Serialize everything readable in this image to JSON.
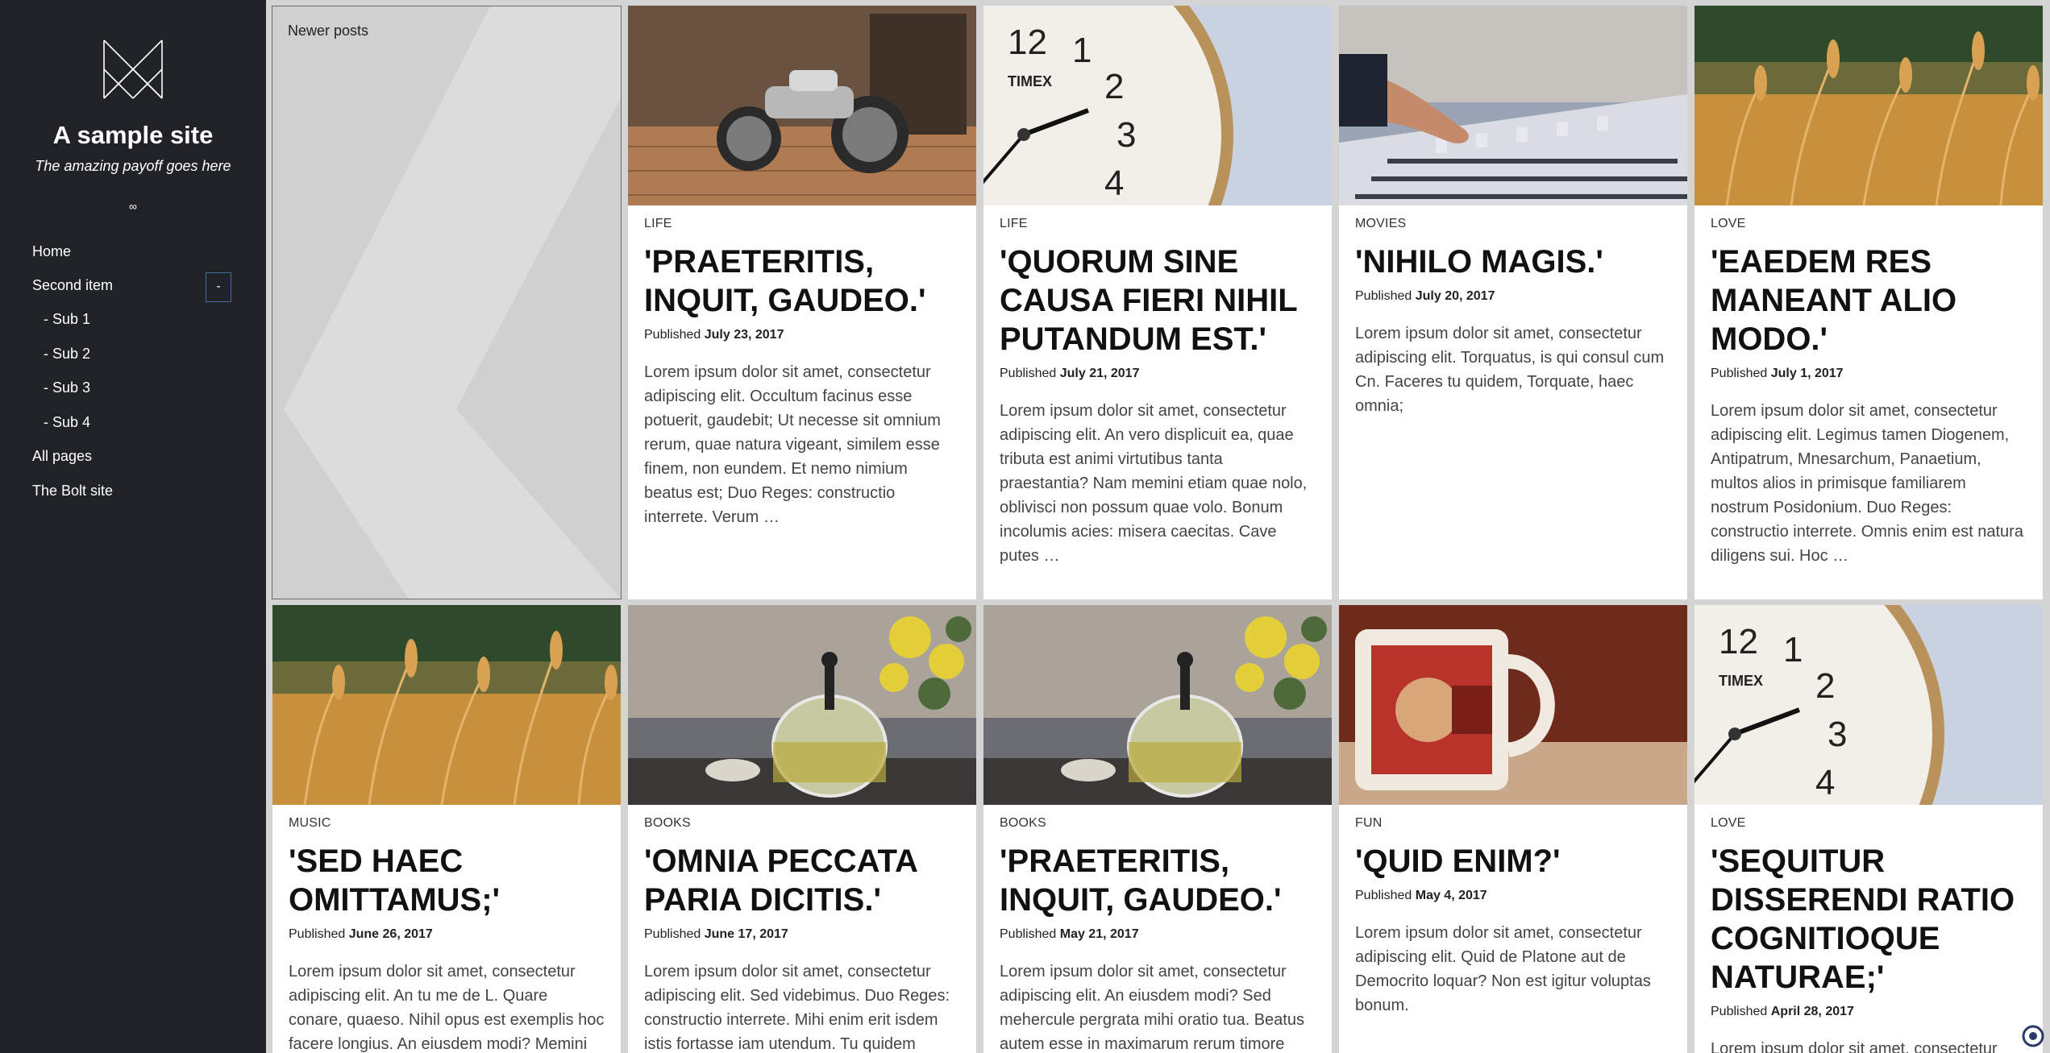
{
  "sidebar": {
    "title": "A sample site",
    "payoff": "The amazing payoff goes here",
    "separator": "∞",
    "nav": [
      {
        "label": "Home"
      },
      {
        "label": "Second item"
      },
      {
        "label": "- Sub 1"
      },
      {
        "label": "- Sub 2"
      },
      {
        "label": "- Sub 3"
      },
      {
        "label": "- Sub 4"
      },
      {
        "label": "All pages"
      },
      {
        "label": "The Bolt site"
      }
    ],
    "toggle_label": "-"
  },
  "pager": {
    "newer_label": "Newer posts"
  },
  "published_label": "Published",
  "posts": [
    {
      "category": "LIFE",
      "title": "'PRAETERITIS, INQUIT, GAUDEO.'",
      "date": "July 23, 2017",
      "image": "motorcycle-garage",
      "excerpt": "Lorem ipsum dolor sit amet, consectetur adipiscing elit. Occultum facinus esse potuerit, gaudebit; Ut necesse sit omnium rerum, quae natura vigeant, similem esse finem, non eundem. Et nemo nimium beatus est; Duo Reges: constructio interrete. Verum …"
    },
    {
      "category": "LIFE",
      "title": "'QUORUM SINE CAUSA FIERI NIHIL PUTANDUM EST.'",
      "date": "July 21, 2017",
      "image": "clock",
      "excerpt": "Lorem ipsum dolor sit amet, consectetur adipiscing elit. An vero displicuit ea, quae tributa est animi virtutibus tanta praestantia? Nam memini etiam quae nolo, oblivisci non possum quae volo. Bonum incolumis acies: misera caecitas. Cave putes …"
    },
    {
      "category": "MOVIES",
      "title": "'NIHILO MAGIS.'",
      "date": "July 20, 2017",
      "image": "mixing-desk",
      "excerpt": "Lorem ipsum dolor sit amet, consectetur adipiscing elit. Torquatus, is qui consul cum Cn. Faceres tu quidem, Torquate, haec omnia;"
    },
    {
      "category": "LOVE",
      "title": "'EAEDEM RES MANEANT ALIO MODO.'",
      "date": "July 1, 2017",
      "image": "wheat-field",
      "excerpt": "Lorem ipsum dolor sit amet, consectetur adipiscing elit. Legimus tamen Diogenem, Antipatrum, Mnesarchum, Panaetium, multos alios in primisque familiarem nostrum Posidonium. Duo Reges: constructio interrete. Omnis enim est natura diligens sui. Hoc …"
    },
    {
      "category": "MUSIC",
      "title": "'SED HAEC OMITTAMUS;'",
      "date": "June 26, 2017",
      "image": "wheat-field",
      "excerpt": "Lorem ipsum dolor sit amet, consectetur adipiscing elit. An tu me de L. Quare conare, quaeso. Nihil opus est exemplis hoc facere longius. An eiusdem modi? Memini"
    },
    {
      "category": "BOOKS",
      "title": "'OMNIA PECCATA PARIA DICITIS.'",
      "date": "June 17, 2017",
      "image": "tea-pot",
      "excerpt": "Lorem ipsum dolor sit amet, consectetur adipiscing elit. Sed videbimus. Duo Reges: constructio interrete. Mihi enim erit isdem istis fortasse iam utendum. Tu quidem"
    },
    {
      "category": "BOOKS",
      "title": "'PRAETERITIS, INQUIT, GAUDEO.'",
      "date": "May 21, 2017",
      "image": "tea-pot",
      "excerpt": "Lorem ipsum dolor sit amet, consectetur adipiscing elit. An eiusdem modi? Sed mehercule pergrata mihi oratio tua. Beatus autem esse in maximarum rerum timore"
    },
    {
      "category": "FUN",
      "title": "'QUID ENIM?'",
      "date": "May 4, 2017",
      "image": "coffee-mug",
      "excerpt": "Lorem ipsum dolor sit amet, consectetur adipiscing elit. Quid de Platone aut de Democrito loquar? Non est igitur voluptas bonum."
    },
    {
      "category": "LOVE",
      "title": "'SEQUITUR DISSERENDI RATIO COGNITIOQUE NATURAE;'",
      "date": "April 28, 2017",
      "image": "clock",
      "excerpt": "Lorem ipsum dolor sit amet, consectetur"
    }
  ],
  "colors": {
    "sidebar_bg": "#1f2227",
    "page_bg": "#d4d4d4",
    "toggle_border": "#4a6a9a"
  },
  "corner_icon": "bolt-settings-icon"
}
